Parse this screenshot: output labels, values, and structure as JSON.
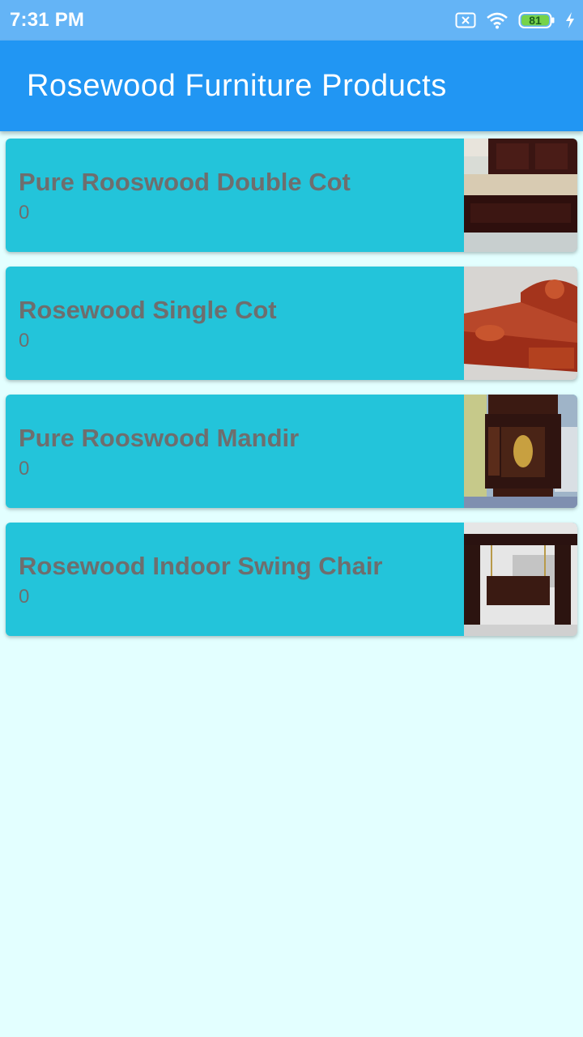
{
  "status_bar": {
    "time": "7:31 PM",
    "battery_level": "81",
    "icons": [
      "notification-x-icon",
      "wifi-icon",
      "battery-icon",
      "charging-icon"
    ]
  },
  "app_bar": {
    "title": "Rosewood Furniture Products"
  },
  "colors": {
    "status_bar": "#64b4f6",
    "app_bar": "#2196f3",
    "card": "#23c4da",
    "background": "#e3ffff",
    "card_text": "#6e6e6e"
  },
  "products": [
    {
      "title": "Pure Rooswood Double Cot",
      "count": "0",
      "image": "double-cot-photo"
    },
    {
      "title": "Rosewood Single Cot",
      "count": "0",
      "image": "single-cot-photo"
    },
    {
      "title": "Pure Rooswood Mandir",
      "count": "0",
      "image": "mandir-photo"
    },
    {
      "title": "Rosewood Indoor Swing Chair",
      "count": "0",
      "image": "swing-chair-photo"
    }
  ]
}
